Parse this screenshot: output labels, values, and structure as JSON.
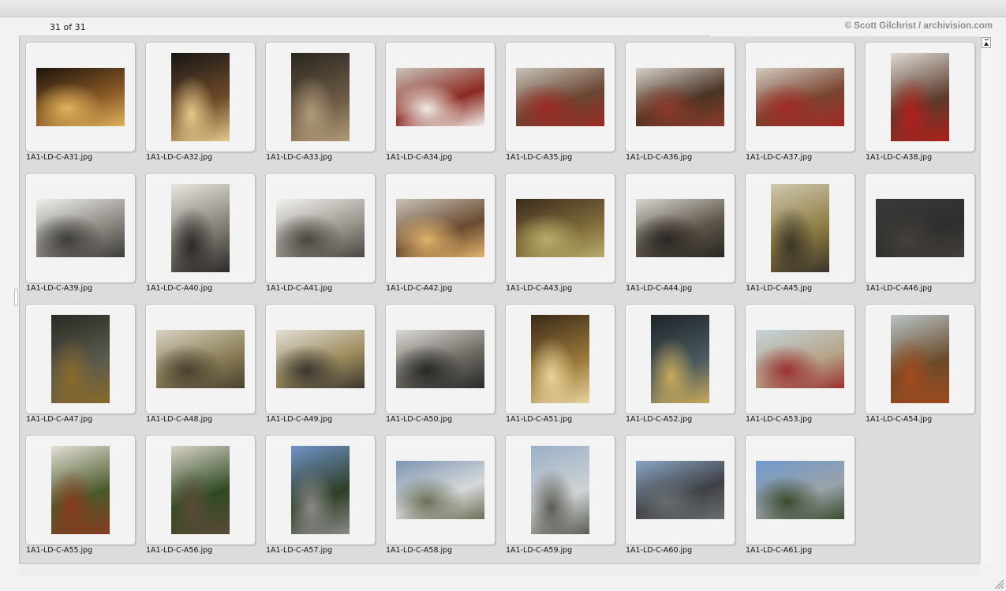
{
  "header": {
    "count_label": "31 of 31",
    "copyright": "© Scott Gilchrist / archivision.com"
  },
  "thumbnails": [
    {
      "filename": "1A1-LD-C-A31.jpg",
      "orientation": "landscape",
      "colors": [
        "#1c140c",
        "#8a5a26",
        "#e0b35c"
      ]
    },
    {
      "filename": "1A1-LD-C-A32.jpg",
      "orientation": "portrait",
      "colors": [
        "#161616",
        "#6e4a2a",
        "#e6c88a"
      ]
    },
    {
      "filename": "1A1-LD-C-A33.jpg",
      "orientation": "portrait",
      "colors": [
        "#2a2620",
        "#6a5a44",
        "#b09a78"
      ]
    },
    {
      "filename": "1A1-LD-C-A34.jpg",
      "orientation": "landscape",
      "colors": [
        "#c9c4ba",
        "#8c2a22",
        "#f1eee8"
      ]
    },
    {
      "filename": "1A1-LD-C-A35.jpg",
      "orientation": "landscape",
      "colors": [
        "#c7c2b8",
        "#6a4632",
        "#9c2a24"
      ]
    },
    {
      "filename": "1A1-LD-C-A36.jpg",
      "orientation": "landscape",
      "colors": [
        "#d5d1ca",
        "#4a3424",
        "#8e3a2a"
      ]
    },
    {
      "filename": "1A1-LD-C-A37.jpg",
      "orientation": "landscape",
      "colors": [
        "#d2cbc0",
        "#7a4430",
        "#a32a24"
      ]
    },
    {
      "filename": "1A1-LD-C-A38.jpg",
      "orientation": "portrait",
      "colors": [
        "#dedbd4",
        "#5a3a2a",
        "#b0201c"
      ]
    },
    {
      "filename": "1A1-LD-C-A39.jpg",
      "orientation": "landscape",
      "colors": [
        "#f0efea",
        "#8a8780",
        "#3e3c38"
      ]
    },
    {
      "filename": "1A1-LD-C-A40.jpg",
      "orientation": "portrait",
      "colors": [
        "#e8e6e0",
        "#7e7a72",
        "#2c2a28"
      ]
    },
    {
      "filename": "1A1-LD-C-A41.jpg",
      "orientation": "landscape",
      "colors": [
        "#f3f2ee",
        "#9a968e",
        "#4a4640"
      ]
    },
    {
      "filename": "1A1-LD-C-A42.jpg",
      "orientation": "landscape",
      "colors": [
        "#c8c2b6",
        "#6a4a30",
        "#e2b36a"
      ]
    },
    {
      "filename": "1A1-LD-C-A43.jpg",
      "orientation": "landscape",
      "colors": [
        "#3a2c1e",
        "#7e6a3a",
        "#b9ad6a"
      ]
    },
    {
      "filename": "1A1-LD-C-A44.jpg",
      "orientation": "landscape",
      "colors": [
        "#d8d5cf",
        "#5a5448",
        "#2a2622"
      ]
    },
    {
      "filename": "1A1-LD-C-A45.jpg",
      "orientation": "portrait",
      "colors": [
        "#d0c8b0",
        "#8a7a3e",
        "#3a342a"
      ]
    },
    {
      "filename": "1A1-LD-C-A46.jpg",
      "orientation": "landscape",
      "colors": [
        "#3a3a38",
        "#2e2e2c",
        "#44403a"
      ]
    },
    {
      "filename": "1A1-LD-C-A47.jpg",
      "orientation": "portrait",
      "colors": [
        "#2a2a24",
        "#5a5a4c",
        "#8a6a2a"
      ]
    },
    {
      "filename": "1A1-LD-C-A48.jpg",
      "orientation": "landscape",
      "colors": [
        "#d8d2c2",
        "#8a7e56",
        "#4a4030"
      ]
    },
    {
      "filename": "1A1-LD-C-A49.jpg",
      "orientation": "landscape",
      "colors": [
        "#e2ded6",
        "#9a8a5a",
        "#3a3630"
      ]
    },
    {
      "filename": "1A1-LD-C-A50.jpg",
      "orientation": "landscape",
      "colors": [
        "#dcdad4",
        "#6a6860",
        "#2a2826"
      ]
    },
    {
      "filename": "1A1-LD-C-A51.jpg",
      "orientation": "portrait",
      "colors": [
        "#3a2a18",
        "#9a7a3a",
        "#e8d39a"
      ]
    },
    {
      "filename": "1A1-LD-C-A52.jpg",
      "orientation": "portrait",
      "colors": [
        "#1e2428",
        "#4a5a5e",
        "#c9a95a"
      ]
    },
    {
      "filename": "1A1-LD-C-A53.jpg",
      "orientation": "landscape",
      "colors": [
        "#c4d4dc",
        "#b6a488",
        "#9a3030"
      ]
    },
    {
      "filename": "1A1-LD-C-A54.jpg",
      "orientation": "portrait",
      "colors": [
        "#b8c4c8",
        "#6a4a2a",
        "#a24a1e"
      ]
    },
    {
      "filename": "1A1-LD-C-A55.jpg",
      "orientation": "portrait",
      "colors": [
        "#e4e0d6",
        "#4a5a2a",
        "#8a3a1e"
      ]
    },
    {
      "filename": "1A1-LD-C-A56.jpg",
      "orientation": "portrait",
      "colors": [
        "#d8d2c6",
        "#2e4a22",
        "#5a4a36"
      ]
    },
    {
      "filename": "1A1-LD-C-A57.jpg",
      "orientation": "portrait",
      "colors": [
        "#6f93c8",
        "#2e3e26",
        "#8a8a86"
      ]
    },
    {
      "filename": "1A1-LD-C-A58.jpg",
      "orientation": "landscape",
      "colors": [
        "#7e96b4",
        "#d6d8da",
        "#6a7056"
      ]
    },
    {
      "filename": "1A1-LD-C-A59.jpg",
      "orientation": "portrait",
      "colors": [
        "#9ab0c8",
        "#cfd2d4",
        "#5a5e52"
      ]
    },
    {
      "filename": "1A1-LD-C-A60.jpg",
      "orientation": "landscape",
      "colors": [
        "#8aa6c4",
        "#3e4044",
        "#6a6e72"
      ]
    },
    {
      "filename": "1A1-LD-C-A61.jpg",
      "orientation": "landscape",
      "colors": [
        "#6f9acc",
        "#9aa2aa",
        "#3a4a2c"
      ]
    }
  ]
}
